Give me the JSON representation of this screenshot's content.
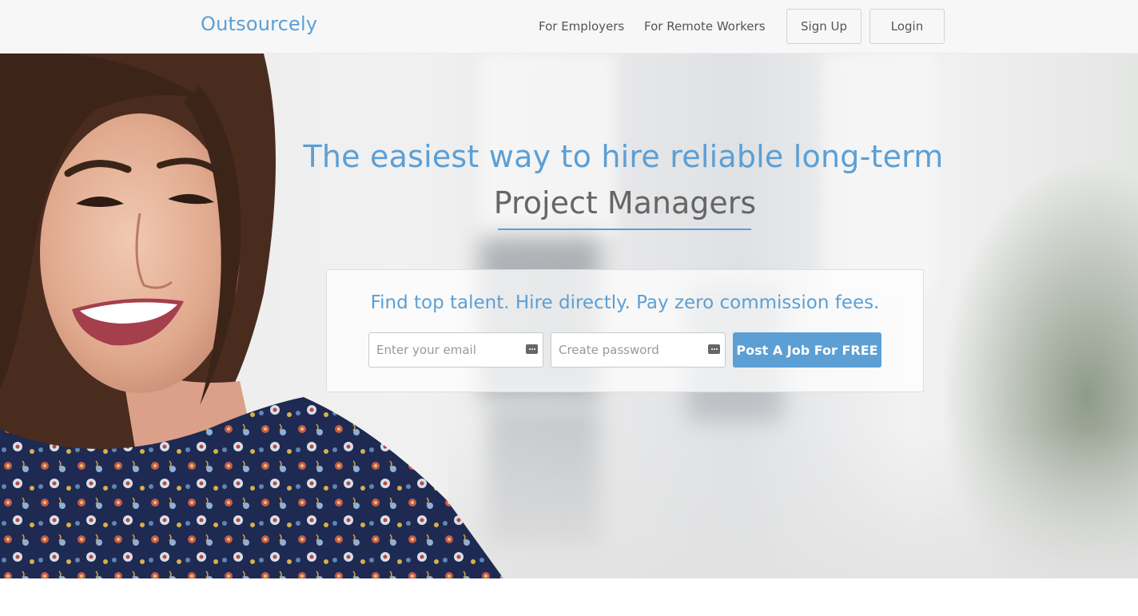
{
  "nav": {
    "brand": "Outsourcely",
    "links": [
      "For Employers",
      "For Remote Workers"
    ],
    "signup_label": "Sign Up",
    "login_label": "Login"
  },
  "hero": {
    "headline": "The easiest way to hire reliable long-term",
    "rotating_role": "Project Managers",
    "tagline": "Find top talent. Hire directly. Pay zero commission fees.",
    "email_placeholder": "Enter your email",
    "password_placeholder": "Create password",
    "cta_label": "Post A Job For FREE"
  },
  "colors": {
    "accent": "#5c9fd4",
    "nav_background": "#f7f7f7",
    "role_text": "#666666"
  }
}
